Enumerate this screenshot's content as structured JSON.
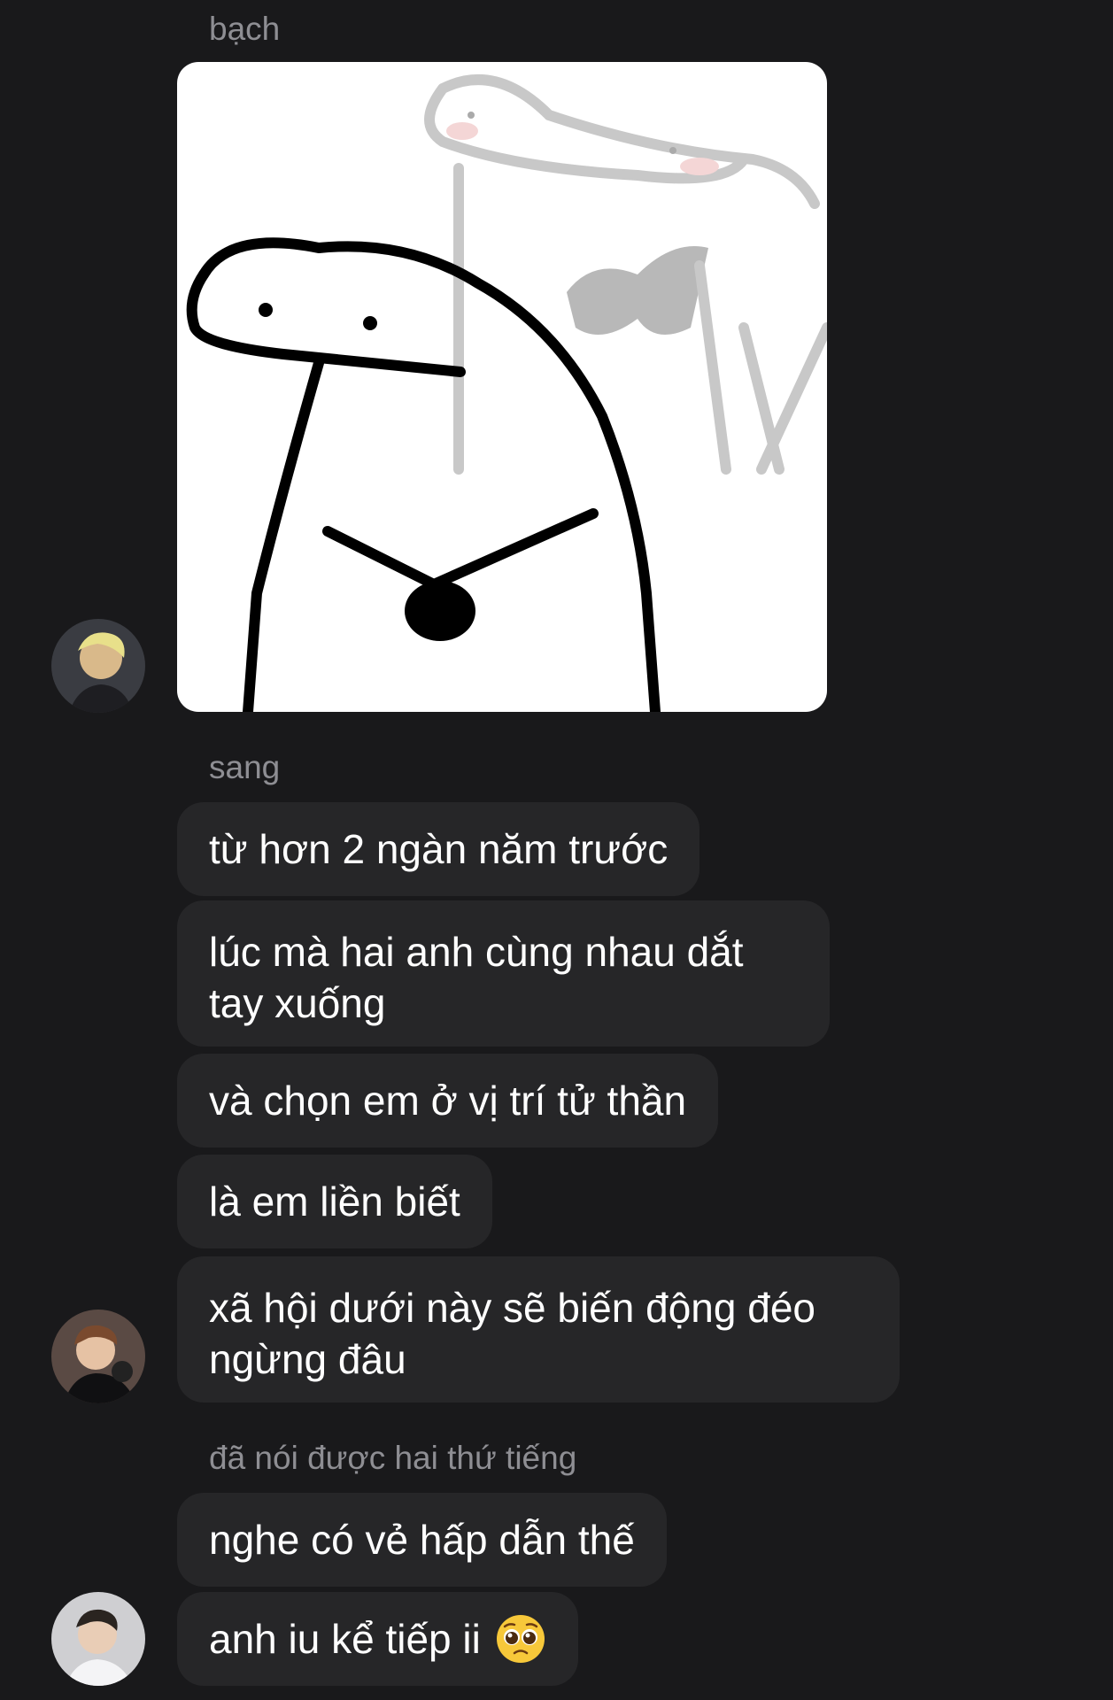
{
  "messages": {
    "group1": {
      "sender": "bạch",
      "image": {
        "icon": "meme-sticker-image"
      }
    },
    "group2": {
      "sender": "sang",
      "texts": [
        "từ hơn 2 ngàn năm trước",
        "lúc mà hai anh cùng nhau dắt tay xuống",
        "và chọn em ở vị trí tử thần",
        "là em liền biết",
        "xã hội dưới này sẽ biến động đéo ngừng đâu"
      ]
    },
    "group3": {
      "sender": "đã nói được hai thứ tiếng",
      "texts": [
        "nghe có vẻ hấp dẫn thế",
        "anh iu kể tiếp ii"
      ],
      "emoji": "pleading-face-emoji"
    }
  },
  "colors": {
    "background": "#19191b",
    "bubble": "#262628",
    "sender_name": "#8e8e93",
    "text": "#ffffff"
  }
}
